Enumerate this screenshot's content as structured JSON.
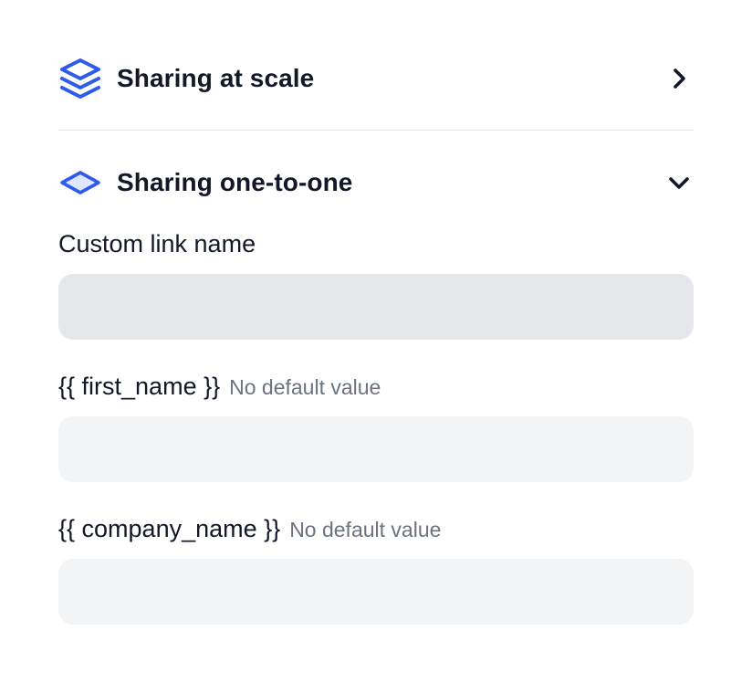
{
  "sections": {
    "scale": {
      "title": "Sharing at scale",
      "icon": "stacked-layers-icon",
      "chevron": "chevron-right-icon",
      "expanded": false
    },
    "one_to_one": {
      "title": "Sharing one-to-one",
      "icon": "single-layer-icon",
      "chevron": "chevron-down-icon",
      "expanded": true
    }
  },
  "form": {
    "custom_link": {
      "label": "Custom link name",
      "value": "",
      "placeholder": ""
    },
    "first_name": {
      "label": "{{ first_name }}",
      "hint": "No default value",
      "value": "",
      "placeholder": ""
    },
    "company_name": {
      "label": "{{ company_name }}",
      "hint": "No default value",
      "value": "",
      "placeholder": ""
    }
  },
  "colors": {
    "accent": "#2f5bea",
    "accent_light": "#dfe6fd",
    "text": "#111827",
    "muted": "#6b7280",
    "input_active_bg": "#e5e7eb",
    "input_bg": "#f3f4f6",
    "divider": "#e5e7eb"
  }
}
